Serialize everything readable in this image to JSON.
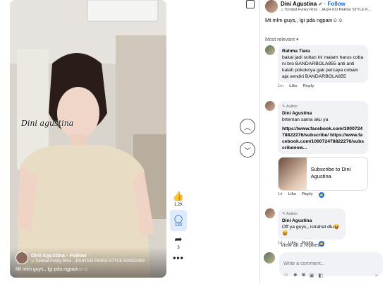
{
  "video": {
    "watermark": "Dini agustina",
    "author": "Dini Agustina",
    "follow": "· Follow",
    "music": "♫ Tombol Fvnky Rmx · JAUH KO PERGI STYLE KONDANG",
    "caption": "Mt mlm guys,, lgi pda ngpain☺☺"
  },
  "actions": {
    "like_count": "1,2K",
    "comment_count": "133",
    "share_count": "3",
    "more": "•••"
  },
  "panel": {
    "author": "Dini Agustina",
    "follow": "· Follow",
    "music": "♫ Tombol Fvnky Rmx · JAUH KO PERGI STYLE K...",
    "caption": "Mt mlm guys,, lgi pda ngpain☺☺",
    "sort": "Most relevant ▾"
  },
  "comments": [
    {
      "name": "Rahma Tiara",
      "text": "bakal jadi sultan ini malam harus coba ni bro BANDARBOLA855 anti anti kalah pokoknya gak percaya cobain aja sendiri BANDARBOLA855",
      "time": "1m",
      "like": "Like",
      "reply": "Reply"
    },
    {
      "tag": "Author",
      "name": "Dini Agustina",
      "text": "brteman sama aku ya",
      "link": "https://www.facebook.com/100072478822276/subscribe/ https://www.facebook.com/100072478822276/subscribenow...",
      "card": "Subscribe to Dini Agustina",
      "time": "1d",
      "like": "Like",
      "reply": "Reply"
    },
    {
      "tag": "Author",
      "name": "Dini Agustina",
      "text": "Off ya guys,, istrahat dlu😝😝",
      "time": "1d",
      "like": "Like",
      "reply": "Reply"
    }
  ],
  "view_all": "View all 2 replies",
  "composer": {
    "placeholder": "Write a comment..."
  },
  "colors": {
    "accent": "#0866ff",
    "bubble": "#f0f2f5"
  }
}
